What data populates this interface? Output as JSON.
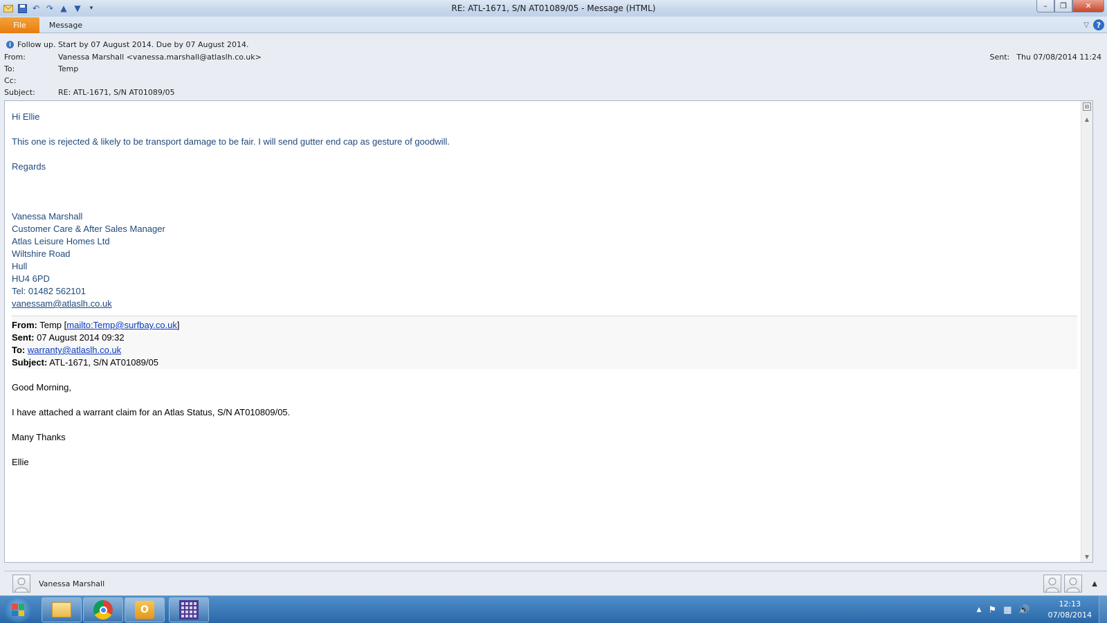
{
  "window": {
    "title": "RE: ATL-1671, S/N AT01089/05  -  Message (HTML)",
    "minimize_glyph": "–",
    "maximize_glyph": "❐",
    "close_glyph": "✕"
  },
  "ribbon": {
    "tabs": [
      "File",
      "Message"
    ],
    "chevron_glyph": "▽",
    "help_glyph": "?"
  },
  "header": {
    "follow_up": "Follow up.  Start by 07 August 2014.  Due by 07 August 2014.",
    "from_label": "From:",
    "from_value": "Vanessa Marshall <vanessa.marshall@atlaslh.co.uk>",
    "to_label": "To:",
    "to_value": "Temp",
    "cc_label": "Cc:",
    "cc_value": "",
    "subject_label": "Subject:",
    "subject_value": "RE: ATL-1671, S/N AT01089/05",
    "sent_label": "Sent:",
    "sent_value": "Thu 07/08/2014 11:24"
  },
  "body": {
    "greeting": "Hi Ellie",
    "message": "This one is rejected & likely to be transport damage to be fair.  I will send gutter end cap as gesture of goodwill.",
    "regards": "Regards",
    "signature": {
      "name": "Vanessa Marshall",
      "role": "Customer Care & After Sales Manager",
      "company": "Atlas Leisure Homes Ltd",
      "street": "Wiltshire Road",
      "city": "Hull",
      "postcode": "HU4 6PD",
      "tel": "Tel: 01482 562101",
      "email": "vanessam@atlaslh.co.uk"
    },
    "quoted": {
      "from_label": "From:",
      "from_name": "Temp",
      "from_link": "mailto:Temp@surfbay.co.uk",
      "sent_label": "Sent:",
      "sent_value": "07 August 2014 09:32",
      "to_label": "To:",
      "to_link": "warranty@atlaslh.co.uk",
      "subject_label": "Subject:",
      "subject_value": "ATL-1671, S/N AT01089/05",
      "greeting": "Good Morning,",
      "message": "I have attached a warrant claim for an Atlas Status, S/N AT010809/05.",
      "thanks": "Many Thanks",
      "signoff": "Ellie"
    }
  },
  "people_pane": {
    "name": "Vanessa Marshall",
    "expand_glyph": "▲"
  },
  "taskbar": {
    "time": "12:13",
    "date": "07/08/2014",
    "tray_up_glyph": "▲",
    "flag_glyph": "⚑",
    "network_glyph": "▦",
    "volume_glyph": "🔊"
  },
  "colors": {
    "signature_blue": "#1f497d",
    "link_blue": "#0b3bbf",
    "file_tab": "#e77d0f",
    "taskbar": "#2a67a8"
  }
}
